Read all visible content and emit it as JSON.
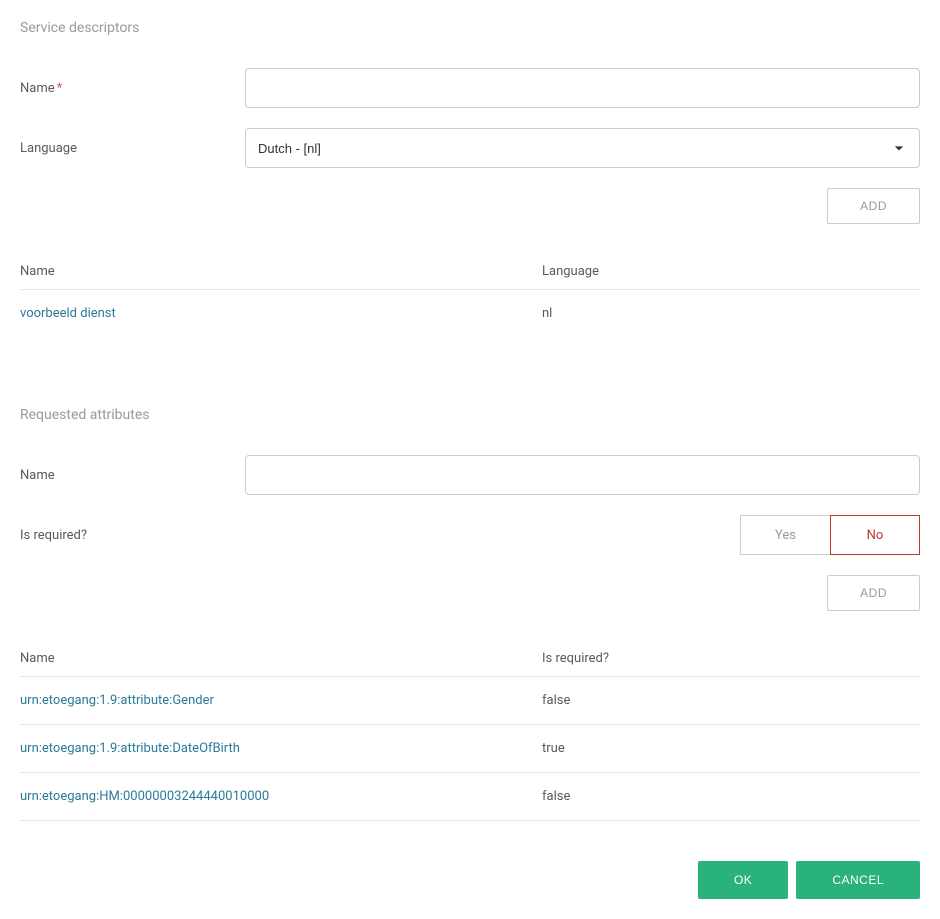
{
  "service_descriptors": {
    "title": "Service descriptors",
    "name_label": "Name",
    "name_value": "",
    "name_required": "*",
    "language_label": "Language",
    "language_value": "Dutch - [nl]",
    "add_label": "ADD",
    "table": {
      "headers": {
        "name": "Name",
        "language": "Language"
      },
      "rows": [
        {
          "name": "voorbeeld dienst",
          "language": "nl"
        }
      ]
    }
  },
  "requested_attributes": {
    "title": "Requested attributes",
    "name_label": "Name",
    "name_value": "",
    "is_required_label": "Is required?",
    "yes_label": "Yes",
    "no_label": "No",
    "add_label": "ADD",
    "table": {
      "headers": {
        "name": "Name",
        "is_required": "Is required?"
      },
      "rows": [
        {
          "name": "urn:etoegang:1.9:attribute:Gender",
          "is_required": "false"
        },
        {
          "name": "urn:etoegang:1.9:attribute:DateOfBirth",
          "is_required": "true"
        },
        {
          "name": "urn:etoegang:HM:00000003244440010000",
          "is_required": "false"
        }
      ]
    }
  },
  "footer": {
    "ok_label": "OK",
    "cancel_label": "CANCEL"
  }
}
